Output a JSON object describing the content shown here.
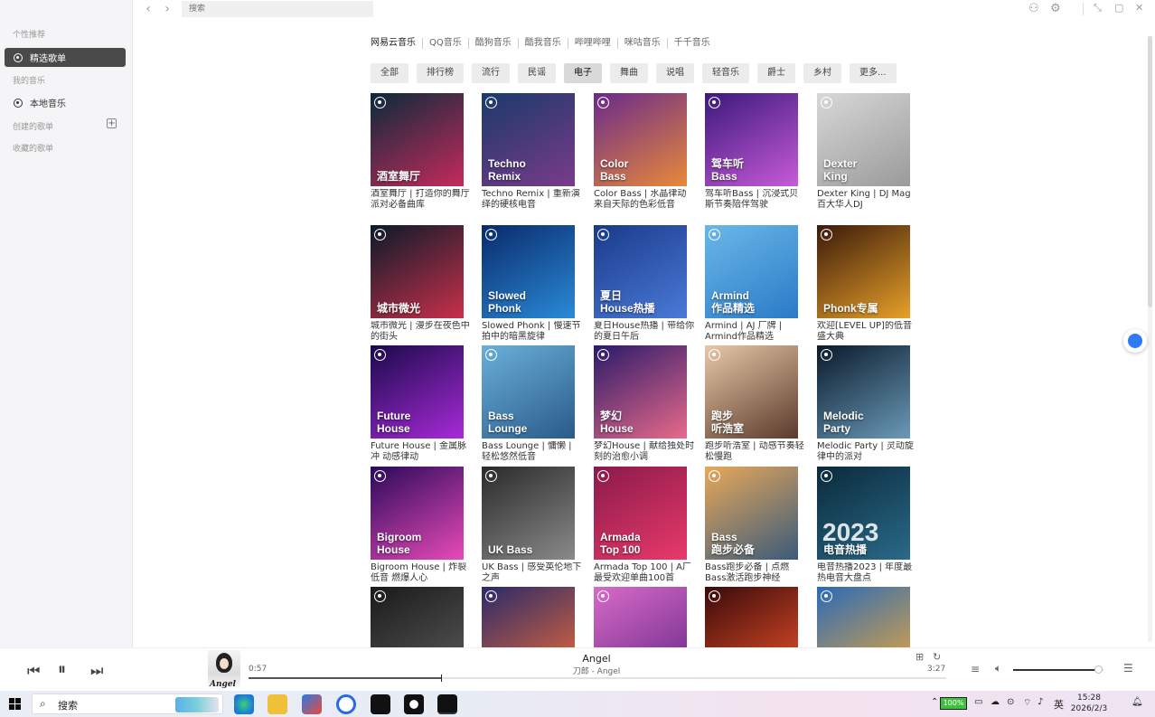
{
  "sidebar": {
    "section_discover": "个性推荐",
    "item_featured": "精选歌单",
    "section_my": "我的音乐",
    "item_local": "本地音乐",
    "section_created": "创建的歌单",
    "section_collected": "收藏的歌单"
  },
  "topbar": {
    "search_placeholder": "搜索"
  },
  "platforms": [
    "网易云音乐",
    "QQ音乐",
    "酷狗音乐",
    "酷我音乐",
    "哔哩哔哩",
    "咪咕音乐",
    "千千音乐"
  ],
  "genres": [
    "全部",
    "排行榜",
    "流行",
    "民谣",
    "电子",
    "舞曲",
    "说唱",
    "轻音乐",
    "爵士",
    "乡村",
    "更多..."
  ],
  "active_genre_index": 4,
  "playlists": [
    {
      "cover_title": "酒室舞厅",
      "desc": "酒室舞厅 | 打造你的舞厅派对必备曲库",
      "colors": [
        "#0a2a3a",
        "#c52a5c"
      ]
    },
    {
      "cover_title": "Techno\nRemix",
      "desc": "Techno Remix | 重新演绎的硬核电音",
      "colors": [
        "#1a3a6a",
        "#7a3b8a"
      ]
    },
    {
      "cover_title": "Color\nBass",
      "desc": "Color Bass | 水晶律动 来自天际的色彩低音",
      "colors": [
        "#6a2a8a",
        "#e8893a"
      ]
    },
    {
      "cover_title": "驾车听\nBass",
      "desc": "驾车听Bass | 沉浸式贝斯节奏陪伴驾驶",
      "colors": [
        "#3a1a7a",
        "#c85ad8"
      ]
    },
    {
      "cover_title": "Dexter\nKing",
      "desc": "Dexter King | DJ Mag百大华人DJ",
      "colors": [
        "#d8d8d8",
        "#9a9a9a"
      ]
    },
    {
      "cover_title": "城市微光",
      "desc": "城市微光 | 漫步在夜色中的街头",
      "colors": [
        "#0a1a2a",
        "#c8304a"
      ]
    },
    {
      "cover_title": "Slowed\nPhonk",
      "desc": "Slowed Phonk | 慢速节拍中的暗黑旋律",
      "colors": [
        "#0a2a6a",
        "#2a8ad8"
      ]
    },
    {
      "cover_title": "夏日\nHouse热播",
      "desc": "夏日House热播 | 带给你的夏日午后",
      "colors": [
        "#1a3a8a",
        "#4a7ad8"
      ]
    },
    {
      "cover_title": "Armind\n作品精选",
      "desc": "Armind | AJ 厂牌 | Armind作品精选",
      "colors": [
        "#6ab8e8",
        "#2a7ac8"
      ]
    },
    {
      "cover_title": "Phonk专属",
      "desc": "欢迎[LEVEL UP]的低音盛大典",
      "colors": [
        "#3a1a0a",
        "#e8a02a"
      ]
    },
    {
      "cover_title": "Future\nHouse",
      "desc": "Future House | 金属脉冲 动感律动",
      "colors": [
        "#1a0a4a",
        "#a82ad8"
      ]
    },
    {
      "cover_title": "Bass\nLounge",
      "desc": "Bass Lounge | 慵懒 | 轻松悠然低音",
      "colors": [
        "#6ab0d8",
        "#2a5a8a"
      ]
    },
    {
      "cover_title": "梦幻\nHouse",
      "desc": "梦幻House | 献给独处时刻的治愈小调",
      "colors": [
        "#2a1a6a",
        "#e86a8a"
      ]
    },
    {
      "cover_title": "跑步\n听浩室",
      "desc": "跑步听浩室 | 动感节奏轻松慢跑",
      "colors": [
        "#e8c8a8",
        "#5a3a2a"
      ]
    },
    {
      "cover_title": "Melodic\nParty",
      "desc": "Melodic Party | 灵动旋律中的派对",
      "colors": [
        "#0a1a2a",
        "#6a9ab8"
      ]
    },
    {
      "cover_title": "Bigroom\nHouse",
      "desc": "Bigroom House | 炸裂低音 燃爆人心",
      "colors": [
        "#2a0a5a",
        "#e84ab8"
      ]
    },
    {
      "cover_title": "UK Bass",
      "desc": "UK Bass | 感受英伦地下之声",
      "colors": [
        "#2a2a2a",
        "#8a8a8a"
      ]
    },
    {
      "cover_title": "Armada\nTop 100",
      "desc": "Armada Top 100 | A厂最受欢迎单曲100首",
      "colors": [
        "#8a1a4a",
        "#e83a6a"
      ]
    },
    {
      "cover_title": "Bass\n跑步必备",
      "desc": "Bass跑步必备 | 点燃Bass激活跑步神经",
      "colors": [
        "#e8a85a",
        "#3a5a7a"
      ]
    },
    {
      "cover_title": "电音热播",
      "desc": "电音热播2023 | 年度最热电音大盘点",
      "colors": [
        "#0a2a3a",
        "#2a6a8a"
      ],
      "big": "2023"
    },
    {
      "cover_title": "",
      "desc": "",
      "colors": [
        "#1a1a1a",
        "#5a5a5a"
      ]
    },
    {
      "cover_title": "",
      "desc": "",
      "colors": [
        "#2a2a6a",
        "#e86a3a"
      ]
    },
    {
      "cover_title": "",
      "desc": "",
      "colors": [
        "#d86ac8",
        "#6a2a8a"
      ]
    },
    {
      "cover_title": "",
      "desc": "",
      "colors": [
        "#3a0a0a",
        "#e8502a"
      ]
    },
    {
      "cover_title": "",
      "desc": "",
      "colors": [
        "#2a6ab8",
        "#e8a83a"
      ]
    }
  ],
  "player": {
    "song_title": "Angel",
    "artist": "刀郎 - Angel",
    "time_current": "0:57",
    "time_total": "3:27",
    "progress": 0.276,
    "volume": 0.95,
    "album_text": "Angel"
  },
  "taskbar": {
    "search_label": "搜索",
    "battery": "100%",
    "ime": "英",
    "time": "15:28",
    "date": "2026/2/3"
  }
}
